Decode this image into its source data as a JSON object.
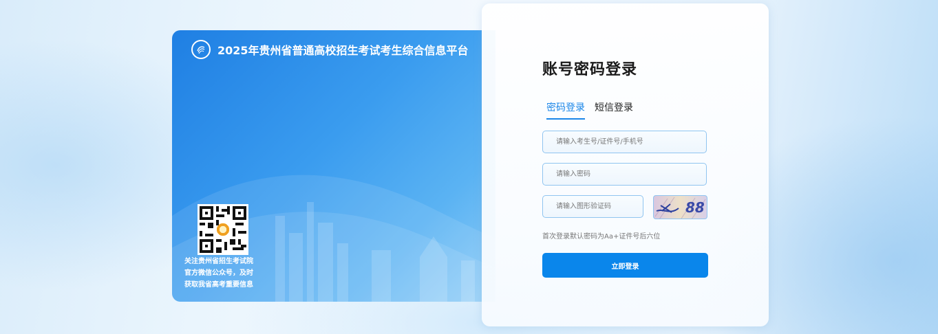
{
  "banner": {
    "title": "2025年贵州省普通高校招生考试考生综合信息平台",
    "qr_caption_lines": [
      "关注贵州省招生考试院",
      "官方微信公众号，及时",
      "获取我省高考重要信息"
    ]
  },
  "login": {
    "title": "账号密码登录",
    "tabs": [
      {
        "label": "密码登录",
        "active": true
      },
      {
        "label": "短信登录",
        "active": false
      }
    ],
    "account_placeholder": "请输入考生号/证件号/手机号",
    "password_placeholder": "请输入密码",
    "captcha_placeholder": "请输入图形验证码",
    "captcha_text": "→ 88",
    "hint": "首次登录默认密码为Aa+证件号后六位",
    "submit_label": "立即登录"
  },
  "colors": {
    "accent": "#0a86eb",
    "panel_blue": "#1f7fe3"
  }
}
